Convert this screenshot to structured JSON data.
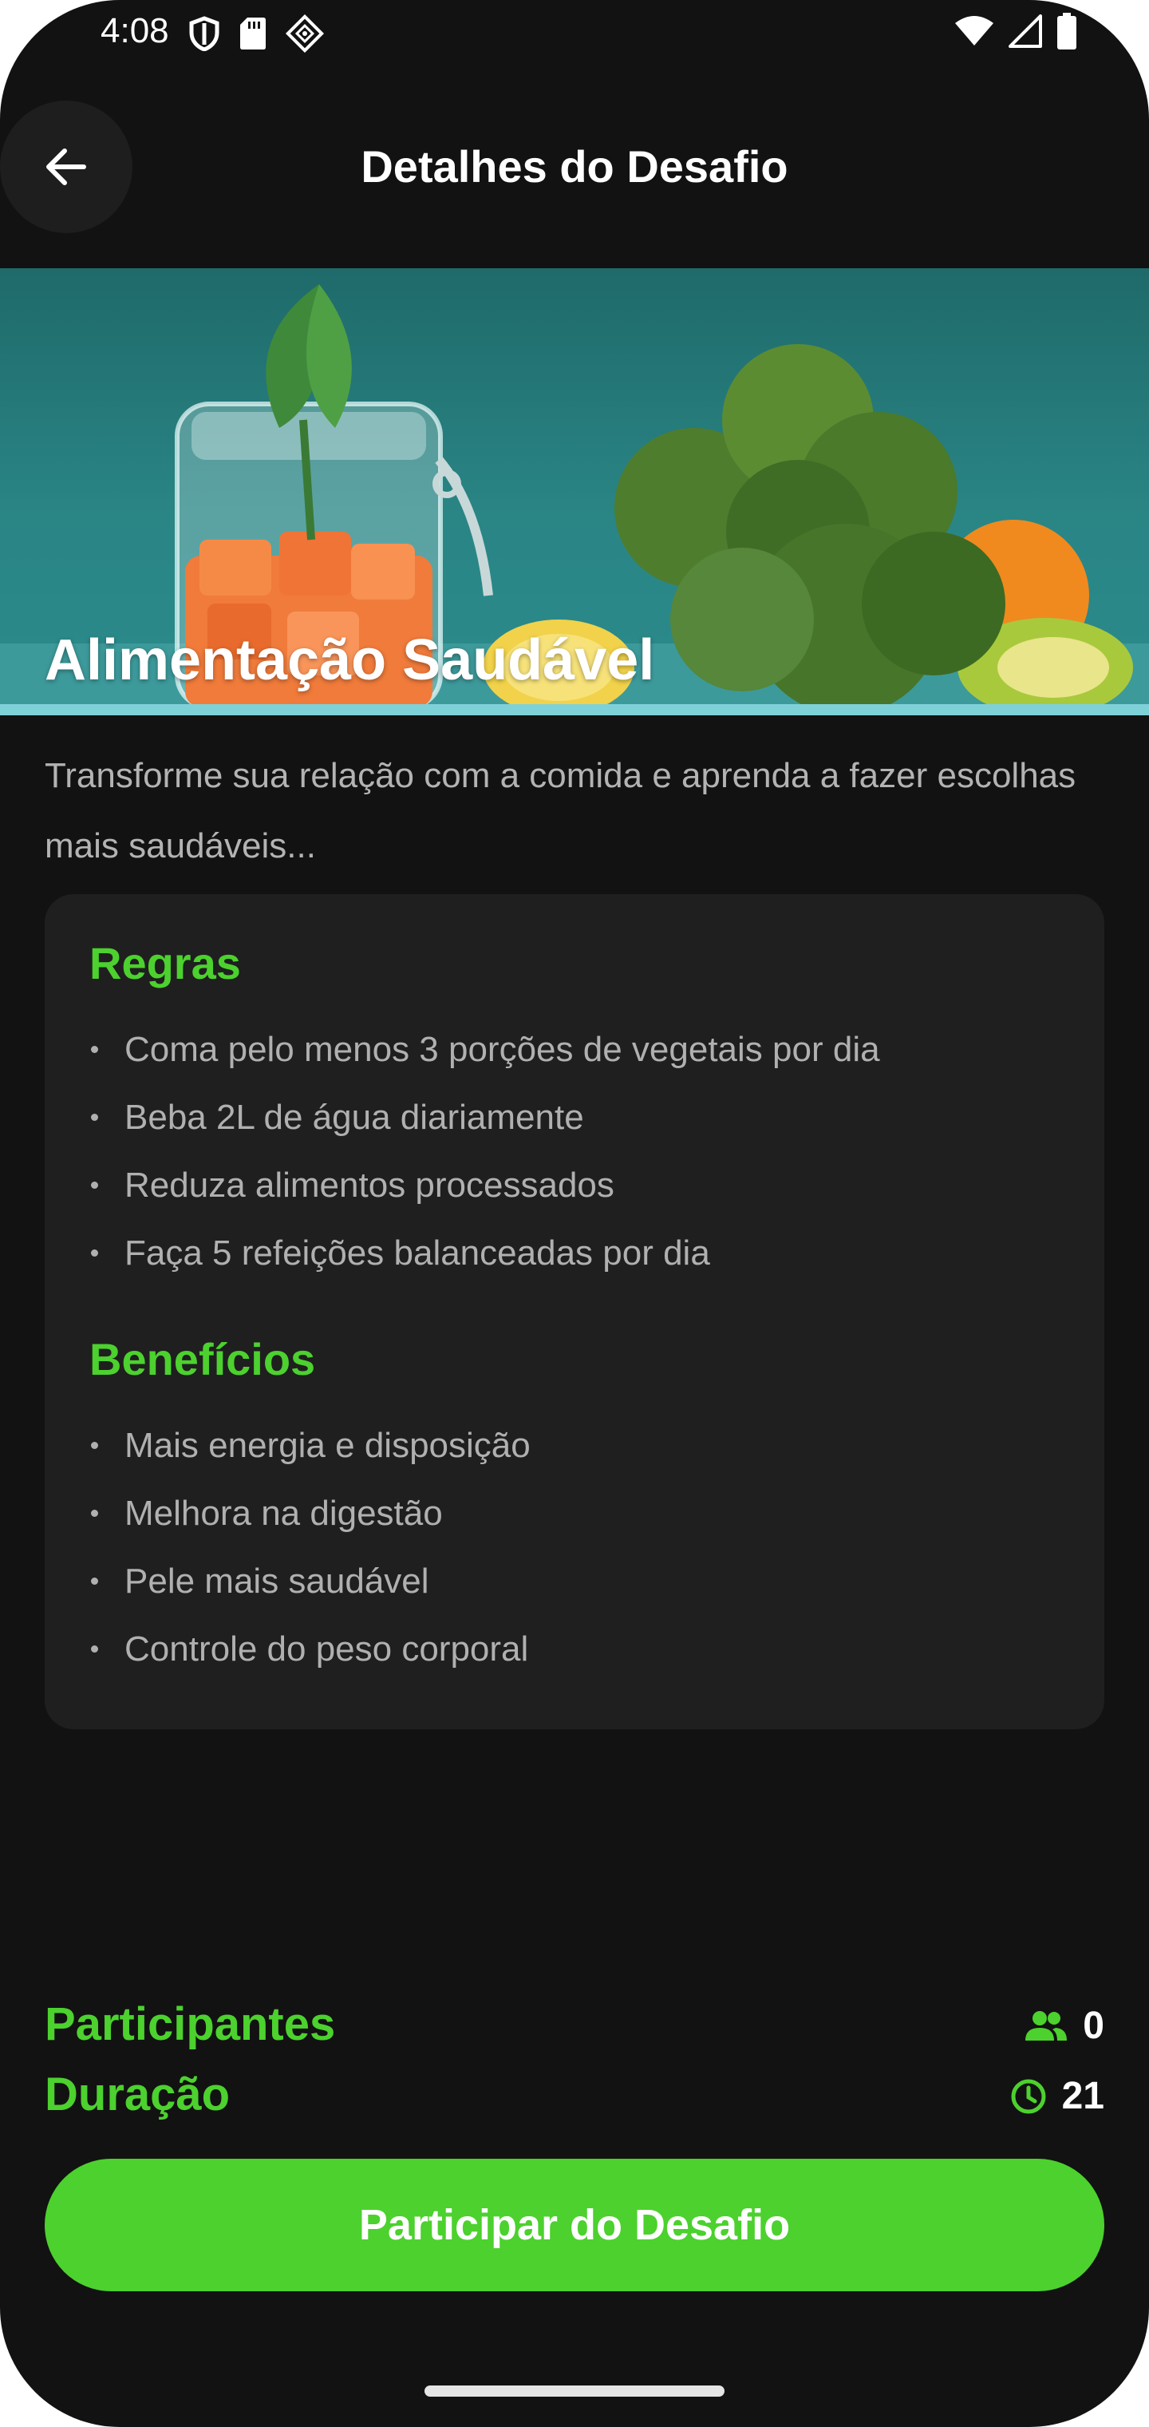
{
  "status_bar": {
    "time": "4:08"
  },
  "app_bar": {
    "title": "Detalhes do Desafio"
  },
  "hero": {
    "title": "Alimentação Saudável"
  },
  "description": "Transforme sua relação com a comida e aprenda a fazer escolhas mais saudáveis...",
  "rules": {
    "title": "Regras",
    "items": [
      "Coma pelo menos 3 porções de vegetais por dia",
      "Beba 2L de água diariamente",
      "Reduza alimentos processados",
      "Faça 5 refeições balanceadas por dia"
    ]
  },
  "benefits": {
    "title": "Benefícios",
    "items": [
      "Mais energia e disposição",
      "Melhora na digestão",
      "Pele mais saudável",
      "Controle do peso corporal"
    ]
  },
  "stats": {
    "participants_label": "Participantes",
    "participants_value": "0",
    "duration_label": "Duração",
    "duration_value": "21"
  },
  "cta": {
    "label": "Participar do Desafio"
  },
  "colors": {
    "accent": "#4cd12e",
    "background": "#121212",
    "card": "#1f1f1f"
  },
  "icons": {
    "back": "arrow-left-icon",
    "participants": "group-icon",
    "duration": "clock-icon"
  }
}
